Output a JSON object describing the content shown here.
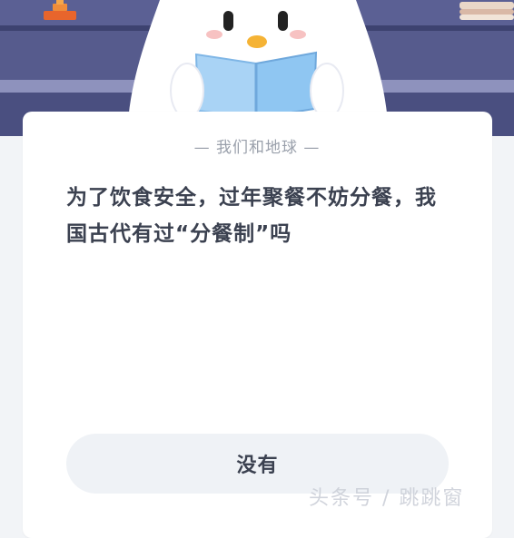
{
  "quiz": {
    "category_label": "— 我们和地球 —",
    "question": "为了饮食安全，过年聚餐不妨分餐，我国古代有过“分餐制”吗",
    "answer_option": "没有"
  },
  "watermark": {
    "text": "头条号 / 跳跳窗"
  },
  "colors": {
    "hero_bg": "#4f5585",
    "card_bg": "#ffffff",
    "page_bg": "#f2f4f7",
    "text_dark": "#3b4150",
    "text_muted": "#9aa0ab",
    "button_bg": "#eff2f6",
    "book_blue": "#8fc6f2"
  },
  "icons": {
    "mascot": "penguin-reading-book-icon",
    "trophy": "trophy-icon",
    "books": "book-stack-icon"
  }
}
